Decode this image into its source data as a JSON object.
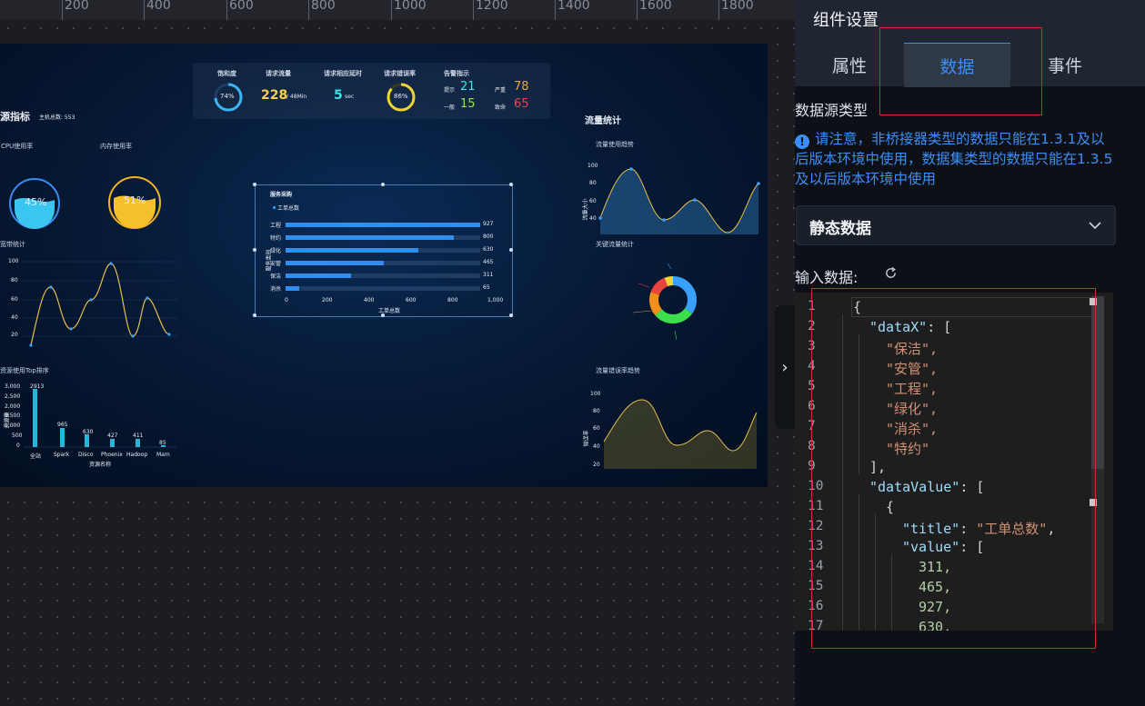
{
  "ruler": {
    "labels": [
      "200",
      "400",
      "600",
      "800",
      "1000",
      "1200",
      "1400",
      "1600",
      "1800"
    ]
  },
  "dashboard": {
    "top": {
      "saturation_title": "饱和度",
      "saturation_value": "74%",
      "requests_title": "请求流量",
      "requests_value": "228",
      "requests_unit": "/ 48Min",
      "latency_title": "请求相应延时",
      "latency_value": "5",
      "latency_unit": "sec",
      "error_title": "请求错误率",
      "error_value": "86%",
      "alarm_title": "告警指示",
      "alarm_hint_label": "提示",
      "alarm_hint_value": "21",
      "alarm_severe_label": "严重",
      "alarm_severe_value": "78",
      "alarm_normal_label": "一般",
      "alarm_normal_value": "15",
      "alarm_fatal_label": "致命",
      "alarm_fatal_value": "65"
    },
    "left": {
      "section_title": "源指标",
      "host_total": "主机总数: 553",
      "cpu_title": "CPU使用率",
      "cpu_value": "45%",
      "mem_title": "内存使用率",
      "mem_value": "51%",
      "bw_title": "宽带统计",
      "bw_yticks": [
        "100",
        "80",
        "60",
        "40",
        "20"
      ],
      "top_title": "资源使用Top排序",
      "top_yticks": [
        "3,000",
        "2,500",
        "2,000",
        "1,500",
        "1,000",
        "500",
        "0"
      ],
      "top_categories": [
        "全站",
        "Spark",
        "Disco",
        "Phoenix",
        "Hadoop",
        "Mam"
      ],
      "top_values": [
        "2913",
        "965",
        "630",
        "427",
        "411",
        "85"
      ],
      "top_xlabel": "资源名称",
      "top_ylabel": "资源量"
    },
    "center": {
      "title": "服务采购",
      "legend": "工单总数",
      "categories": [
        "工程",
        "特约",
        "绿化",
        "安管",
        "保洁",
        "消杀"
      ],
      "values": [
        "927",
        "800",
        "630",
        "465",
        "311",
        "65"
      ],
      "xticks": [
        "0",
        "200",
        "400",
        "600",
        "800",
        "1,000"
      ],
      "xlabel": "工单总数",
      "ylabel": "服务类别"
    },
    "right": {
      "section_title": "流量统计",
      "trend_title": "流量使用趋势",
      "trend_yticks": [
        "100",
        "80",
        "60",
        "40"
      ],
      "trend_ylabel": "流量大小",
      "key_title": "关键流量统计",
      "err_title": "流量错误率趋势",
      "err_yticks": [
        "100",
        "80",
        "60",
        "40",
        "20"
      ],
      "err_ylabel": "错误率"
    }
  },
  "panel": {
    "title": "组件设置",
    "tabs": [
      "属性",
      "数据",
      "事件"
    ],
    "active_tab": "数据",
    "datasource_label": "数据源类型",
    "notice": "请注意，非桥接器类型的数据只能在1.3.1及以后版本环境中使用，数据集类型的数据只能在1.3.5及以后版本环境中使用",
    "select_value": "静态数据",
    "input_label": "输入数据:"
  },
  "editor": {
    "line_numbers": [
      "1",
      "2",
      "3",
      "4",
      "5",
      "6",
      "7",
      "8",
      "9",
      "10",
      "11",
      "12",
      "13",
      "14",
      "15",
      "16",
      "17"
    ],
    "key_dataX": "\"dataX\"",
    "dataX_items": [
      "\"保洁\",",
      "\"安管\",",
      "\"工程\",",
      "\"绿化\",",
      "\"消杀\",",
      "\"特约\""
    ],
    "key_dataValue": "\"dataValue\"",
    "key_title": "\"title\"",
    "title_value": "\"工单总数\"",
    "key_value": "\"value\"",
    "values": [
      "311,",
      "465,",
      "927,",
      "630,"
    ]
  }
}
